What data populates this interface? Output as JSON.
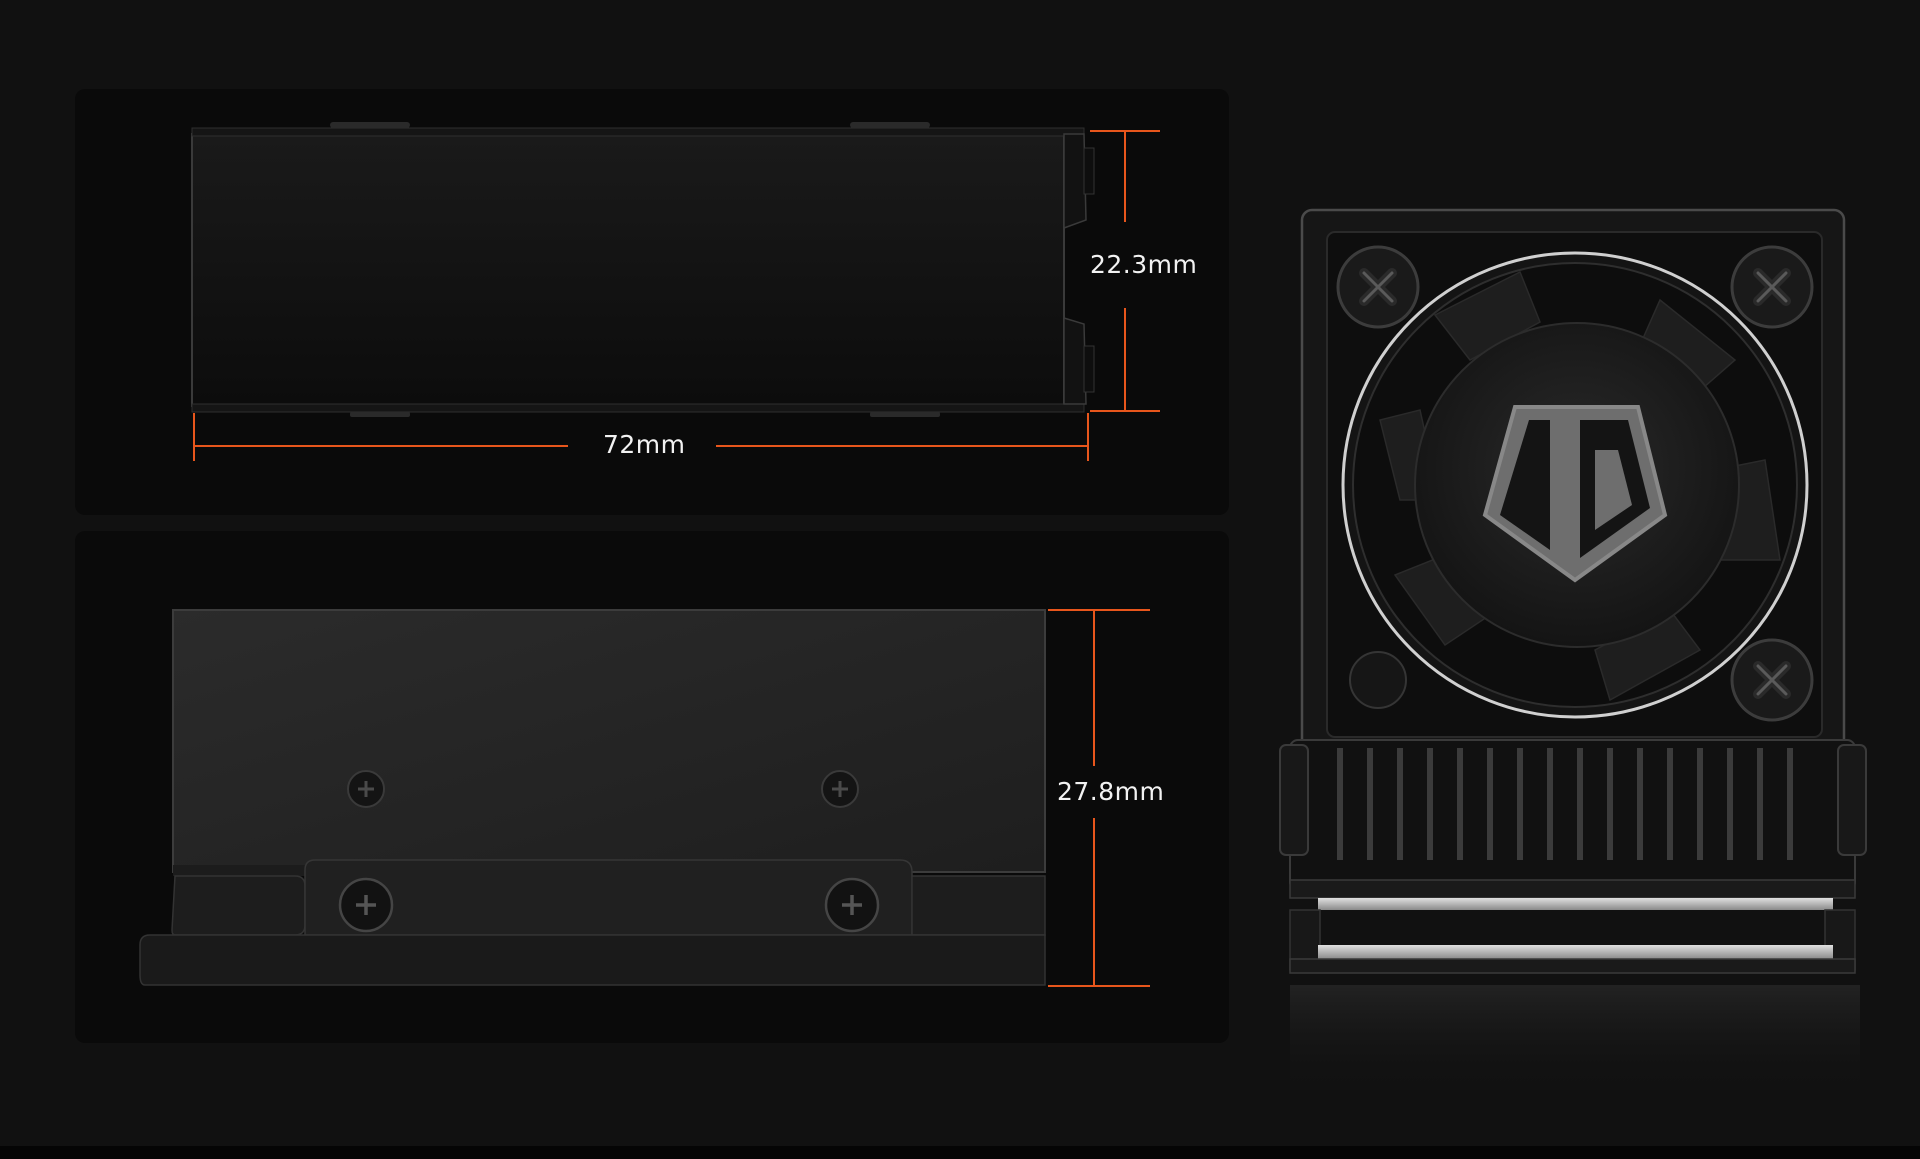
{
  "dimensions": {
    "top_height": "22.3mm",
    "top_length": "72mm",
    "bottom_height": "27.8mm"
  },
  "colors": {
    "background": "#111111",
    "panel": "#0a0a0a",
    "dimension_line": "#e8561c",
    "dimension_text": "#f2f2f2"
  },
  "icons": {
    "fan_logo": "shield-id-logo-icon",
    "screw": "phillips-screw-icon"
  }
}
